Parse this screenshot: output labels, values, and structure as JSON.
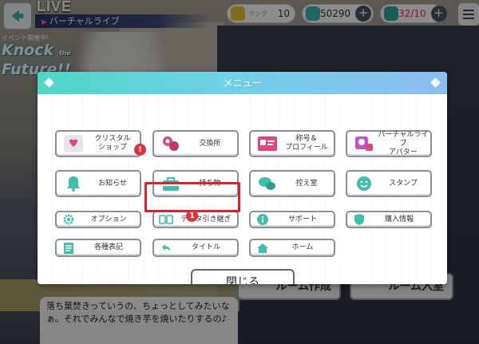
{
  "header": {
    "title": "LIVE",
    "subtitle": "バーチャルライブ",
    "rank_label": "ランク",
    "rank_value": "10",
    "jewels": "50290",
    "stamina": "32/10"
  },
  "event_logo": {
    "line1": "イベント開催中!",
    "line2": "Knock",
    "line3": "the",
    "line4": "Future!!"
  },
  "room_buttons": {
    "create": "ルーム作成",
    "join": "ルーム入室"
  },
  "dialog": {
    "text": "落ち葉焚きっていうの、ちょっとしてみたいなぁ。それでみんなで焼き芋を焼いたりするの♪"
  },
  "menu": {
    "title": "メニュー",
    "items": [
      {
        "label": "クリスタル\nショップ",
        "icon": "crystal-hearts-icon"
      },
      {
        "label": "交換所",
        "icon": "exchange-coins-icon"
      },
      {
        "label": "称号＆\nプロフィール",
        "icon": "profile-card-icon"
      },
      {
        "label": "バーチャルライブ\nアバター",
        "icon": "avatar-icon"
      },
      {
        "label": "お知らせ",
        "icon": "bell-icon"
      },
      {
        "label": "持ち物",
        "icon": "bag-icon"
      },
      {
        "label": "控え室",
        "icon": "chat-icon"
      },
      {
        "label": "スタンプ",
        "icon": "smile-icon"
      },
      {
        "label": "オプション",
        "icon": "gear-icon"
      },
      {
        "label": "データ引き継ぎ",
        "icon": "data-transfer-icon"
      },
      {
        "label": "サポート",
        "icon": "info-icon"
      },
      {
        "label": "購入情報",
        "icon": "shield-icon"
      },
      {
        "label": "各種表記",
        "icon": "document-icon"
      },
      {
        "label": "タイトル",
        "icon": "return-icon"
      },
      {
        "label": "ホーム",
        "icon": "home-icon"
      }
    ],
    "close_label": "閉じる"
  },
  "badges": {
    "news": "!",
    "step": "1"
  },
  "colors": {
    "accent_teal": "#4fd6c7",
    "highlight_red": "#e0202a"
  }
}
